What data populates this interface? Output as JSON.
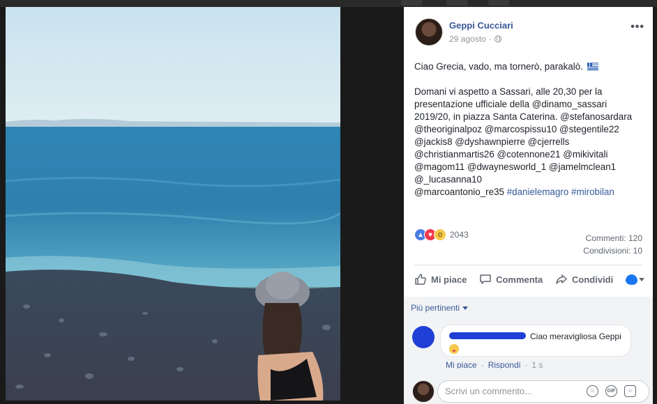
{
  "post": {
    "author": "Geppi Cucciari",
    "date": "29 agosto",
    "audience_icon": "globe-icon",
    "more_label": "•••",
    "text_line1": "Ciao Grecia, vado, ma tornerò, parakalò.",
    "text_body": "Domani vi aspetto a Sassari, alle 20,30 per la presentazione ufficiale della @dinamo_sassari 2019/20, in piazza Santa Caterina. @stefanosardara @theoriginalpoz @marcospissu10 @stegentile22 @jackis8 @dyshawnpierre @cjerrells @christianmartis26 @cotennone21 @mikivitali @magom11 @dwaynesworld_1 @jamelmclean1 @_lucasanna10",
    "text_tail": "@marcoantonio_re35",
    "hashtag1": "#danielemagro",
    "hashtag2": "#mirobilan"
  },
  "reactions": {
    "count": "2043",
    "types": [
      "like-icon",
      "love-icon",
      "wow-icon"
    ]
  },
  "stats": {
    "comments": "Commenti: 120",
    "shares": "Condivisioni: 10"
  },
  "actions": {
    "like": "Mi piace",
    "comment": "Commenta",
    "share": "Condividi"
  },
  "comments": {
    "filter_label": "Più pertinenti",
    "items": [
      {
        "text": "Ciao meravigliosa Geppi",
        "like_link": "Mi piace",
        "reply_link": "Rispondi",
        "age": "1 s"
      }
    ],
    "placeholder": "Scrivi un commento...",
    "gif_label": "GIF"
  },
  "colors": {
    "link": "#385898",
    "like_reaction": "#4a7de2",
    "love_reaction": "#f0384e",
    "wow_reaction": "#f7c94a",
    "redaction": "#1f3fd6"
  }
}
